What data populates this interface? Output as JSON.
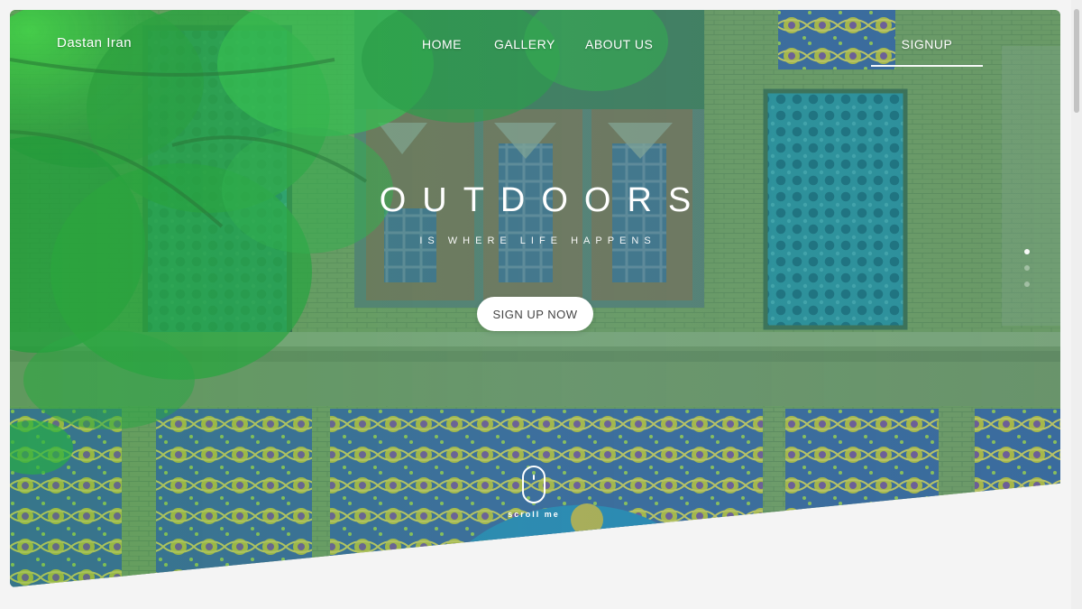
{
  "nav": {
    "brand": "Dastan Iran",
    "links": [
      "HOME",
      "GALLERY",
      "ABOUT US"
    ],
    "signup": "SIGNUP"
  },
  "hero": {
    "title": "OUTDOORS",
    "subtitle": "IS WHERE LIFE HAPPENS",
    "cta": "SIGN UP NOW",
    "scroll_label": "scroll me"
  },
  "colors": {
    "overlay": "#2aa84a",
    "text": "#ffffff",
    "button_bg": "#ffffff",
    "button_text": "#444444",
    "page_bg": "#f4f4f4"
  },
  "icons": {
    "scroll": "mouse-scroll-icon",
    "pager": "pager-dot-icon"
  }
}
